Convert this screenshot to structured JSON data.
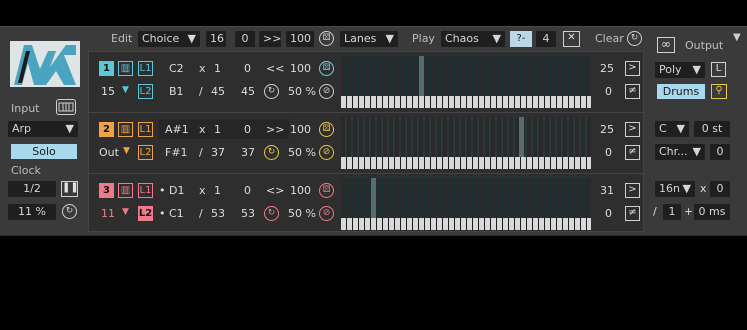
{
  "header": {
    "edit_label": "Edit",
    "edit_mode": "Choice",
    "edit_v1": "16",
    "edit_v2": "0",
    "edit_shift": ">>",
    "edit_v3": "100",
    "view_mode": "Lanes",
    "play_label": "Play",
    "play_mode": "Chaos",
    "play_q": "?-",
    "play_v": "4",
    "clear_label": "Clear",
    "output_label": "Output"
  },
  "left": {
    "input_label": "Input",
    "input_mode": "Arp",
    "solo_label": "Solo",
    "clock_label": "Clock",
    "clock_rate": "1/2",
    "clock_swing": "11 %"
  },
  "right": {
    "voice_mode": "Poly",
    "voice_L": "L",
    "drums_label": "Drums",
    "note_C": "C",
    "transpose": "0 st",
    "scale": "Chr...",
    "scale_v": "0",
    "rate": "16n",
    "rate_mult": "x",
    "rate_v": "0",
    "div_slash": "/",
    "div_v": "1",
    "plus": "+",
    "delay": "0 ms"
  },
  "lanes": [
    {
      "num": "1",
      "l1": "L1",
      "l2": "L2",
      "note1": "C2",
      "x": "x",
      "v1": "1",
      "v2": "0",
      "dir": "<<",
      "vel": "100",
      "count": "15",
      "note2": "B1",
      "slash": "/",
      "len": "45",
      "len2": "45",
      "prob": "50 %",
      "right1": "25",
      "right2": "0",
      "btn1": ">",
      "btn2": "≠"
    },
    {
      "num": "2",
      "l1": "L1",
      "l2": "L2",
      "note1": "A#1",
      "x": "x",
      "v1": "1",
      "v2": "0",
      "dir": ">>",
      "vel": "100",
      "count": "Out",
      "note2": "F#1",
      "slash": "/",
      "len": "37",
      "len2": "37",
      "prob": "50 %",
      "right1": "25",
      "right2": "0",
      "btn1": ">",
      "btn2": "≠"
    },
    {
      "num": "3",
      "l1": "L1",
      "l2": "L2",
      "note1": "• D1",
      "x": "x",
      "v1": "1",
      "v2": "0",
      "dir": "<>",
      "vel": "100",
      "count": "11",
      "note2": "• C1",
      "slash": "/",
      "len": "53",
      "len2": "53",
      "prob": "50 %",
      "right1": "31",
      "right2": "0",
      "btn1": ">",
      "btn2": "≠"
    }
  ],
  "colors": {
    "lane1": "#5bc7d8",
    "lane2": "#f0a248",
    "lane3": "#f07a8c",
    "accent_blue": "#7ad0e6",
    "accent_yellow": "#e8c84a"
  },
  "icons": {
    "dice": "dice-icon",
    "reset": "reset-icon",
    "loop": "infinity-icon",
    "collapse": "triangle-down-icon",
    "piano": "piano-icon",
    "pin": "pin-icon"
  }
}
